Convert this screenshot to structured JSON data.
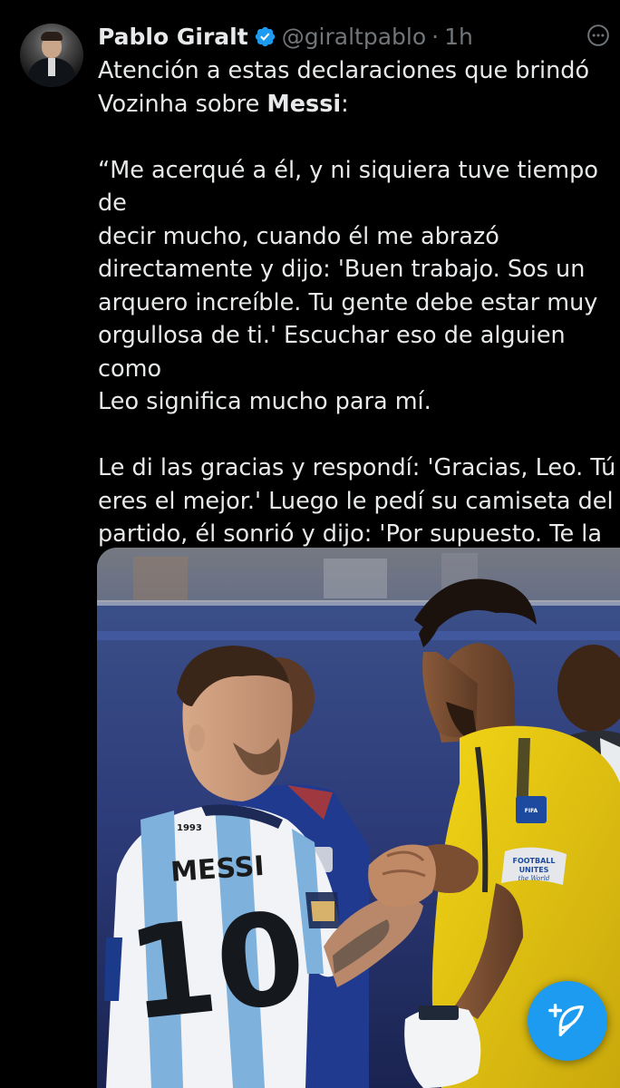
{
  "tweet": {
    "author_name": "Pablo Giralt",
    "handle": "@giraltpablo",
    "separator": "·",
    "time": "1h",
    "text_line1": "Atención a estas declaraciones que brindó",
    "text_line2_prefix": "Vozinha sobre ",
    "text_line2_bold": "Messi",
    "text_line2_suffix": ":",
    "quote_paragraph_1": "“Me acerqué a él, y ni siquiera tuve tiempo de\ndecir mucho, cuando él me abrazó\ndirectamente y dijo: 'Buen trabajo. Sos un\narquero increíble. Tu gente debe estar muy\norgullosa de ti.' Escuchar eso de alguien como\nLeo significa mucho para mí.",
    "quote_paragraph_2": "Le di las gracias y respondí: 'Gracias, Leo. Tú\neres el mejor.' Luego le pedí su camiseta del\npartido, él sonrió y dijo: 'Por supuesto. Te la\ndaré en el túnel de vestuarios.' Momentos\ncomo este los recordaré toda la vida.\""
  },
  "media": {
    "jersey_name": "MESSI",
    "jersey_number": "10",
    "jersey_year": "1993",
    "armband_line1": "FOOTBALL",
    "armband_line2": "UNITES",
    "armband_line3": "the World"
  },
  "icons": {
    "verified": "verified-badge-icon",
    "more": "more-options-icon",
    "compose": "compose-post-icon"
  },
  "colors": {
    "background": "#000000",
    "text": "#e7e9ea",
    "secondary_text": "#71767b",
    "accent": "#1d9bf0"
  }
}
